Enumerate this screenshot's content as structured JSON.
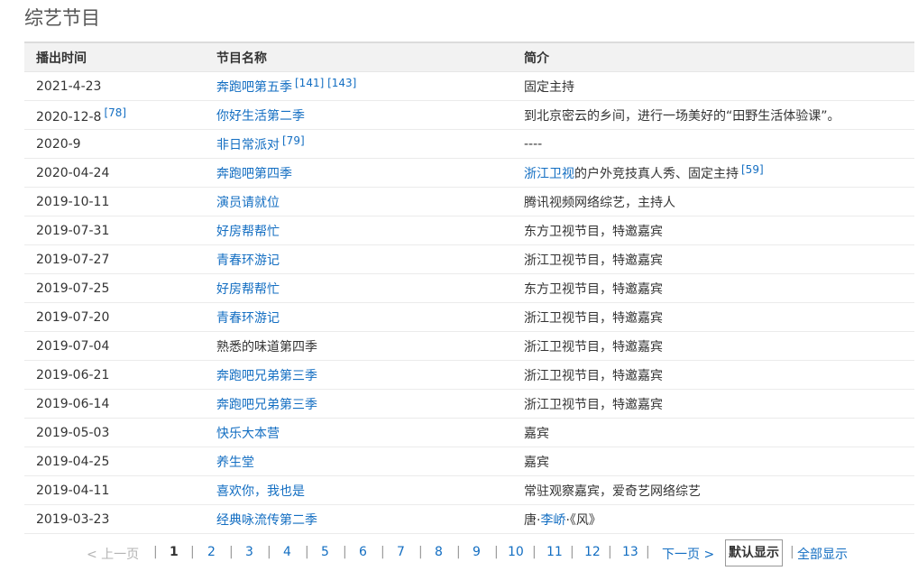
{
  "section": {
    "title": "综艺节目"
  },
  "table": {
    "headers": [
      "播出时间",
      "节目名称",
      "简介"
    ],
    "rows": [
      {
        "date": "2021-4-23",
        "date_ref": "",
        "name": "奔跑吧第五季",
        "name_link": true,
        "name_refs": "[141] [143]",
        "desc_link": "",
        "desc": "固定主持",
        "desc_ref": ""
      },
      {
        "date": "2020-12-8",
        "date_ref": "[78]",
        "name": "你好生活第二季",
        "name_link": true,
        "name_refs": "",
        "desc_link": "",
        "desc": "到北京密云的乡间，进行一场美好的“田野生活体验课”。",
        "desc_ref": ""
      },
      {
        "date": "2020-9",
        "date_ref": "",
        "name": "非日常派对",
        "name_link": true,
        "name_refs": "[79]",
        "desc_link": "",
        "desc": "----",
        "desc_ref": ""
      },
      {
        "date": "2020-04-24",
        "date_ref": "",
        "name": "奔跑吧第四季",
        "name_link": true,
        "name_refs": "",
        "desc_link": "浙江卫视",
        "desc": "的户外竞技真人秀、固定主持",
        "desc_ref": "[59]"
      },
      {
        "date": "2019-10-11",
        "date_ref": "",
        "name": "演员请就位",
        "name_link": true,
        "name_refs": "",
        "desc_link": "",
        "desc": "腾讯视频网络综艺，主持人",
        "desc_ref": ""
      },
      {
        "date": "2019-07-31",
        "date_ref": "",
        "name": "好房帮帮忙",
        "name_link": true,
        "name_refs": "",
        "desc_link": "",
        "desc": "东方卫视节目，特邀嘉宾",
        "desc_ref": ""
      },
      {
        "date": "2019-07-27",
        "date_ref": "",
        "name": "青春环游记",
        "name_link": true,
        "name_refs": "",
        "desc_link": "",
        "desc": "浙江卫视节目，特邀嘉宾",
        "desc_ref": ""
      },
      {
        "date": "2019-07-25",
        "date_ref": "",
        "name": "好房帮帮忙",
        "name_link": true,
        "name_refs": "",
        "desc_link": "",
        "desc": "东方卫视节目，特邀嘉宾",
        "desc_ref": ""
      },
      {
        "date": "2019-07-20",
        "date_ref": "",
        "name": "青春环游记",
        "name_link": true,
        "name_refs": "",
        "desc_link": "",
        "desc": "浙江卫视节目，特邀嘉宾",
        "desc_ref": ""
      },
      {
        "date": "2019-07-04",
        "date_ref": "",
        "name": "熟悉的味道第四季",
        "name_link": false,
        "name_refs": "",
        "desc_link": "",
        "desc": "浙江卫视节目，特邀嘉宾",
        "desc_ref": ""
      },
      {
        "date": "2019-06-21",
        "date_ref": "",
        "name": "奔跑吧兄弟第三季",
        "name_link": true,
        "name_refs": "",
        "desc_link": "",
        "desc": "浙江卫视节目，特邀嘉宾",
        "desc_ref": ""
      },
      {
        "date": "2019-06-14",
        "date_ref": "",
        "name": "奔跑吧兄弟第三季",
        "name_link": true,
        "name_refs": "",
        "desc_link": "",
        "desc": "浙江卫视节目，特邀嘉宾",
        "desc_ref": ""
      },
      {
        "date": "2019-05-03",
        "date_ref": "",
        "name": "快乐大本营",
        "name_link": true,
        "name_refs": "",
        "desc_link": "",
        "desc": "嘉宾",
        "desc_ref": ""
      },
      {
        "date": "2019-04-25",
        "date_ref": "",
        "name": "养生堂",
        "name_link": true,
        "name_refs": "",
        "desc_link": "",
        "desc": "嘉宾",
        "desc_ref": ""
      },
      {
        "date": "2019-04-11",
        "date_ref": "",
        "name": "喜欢你，我也是",
        "name_link": true,
        "name_refs": "",
        "desc_link": "",
        "desc": "常驻观察嘉宾，爱奇艺网络综艺",
        "desc_ref": ""
      },
      {
        "date": "2019-03-23",
        "date_ref": "",
        "name": "经典咏流传第二季",
        "name_link": true,
        "name_refs": "",
        "desc_link": "",
        "desc": "唐·李峤·《风》",
        "desc_ref": "",
        "desc_parts": [
          {
            "text": "唐·",
            "link": false
          },
          {
            "text": "李峤",
            "link": true
          },
          {
            "text": "·《风》",
            "link": false
          }
        ]
      }
    ]
  },
  "pager": {
    "prev": "< 上一页",
    "pages": [
      "1",
      "2",
      "3",
      "4",
      "5",
      "6",
      "7",
      "8",
      "9",
      "10",
      "11",
      "12",
      "13"
    ],
    "current": "1",
    "separator": "|",
    "next": "下一页 >",
    "default_view": "默认显示",
    "all_view": "全部显示"
  },
  "colors": {
    "link": "#136ec2",
    "text": "#333333",
    "header_bg": "#f2f2f2"
  }
}
